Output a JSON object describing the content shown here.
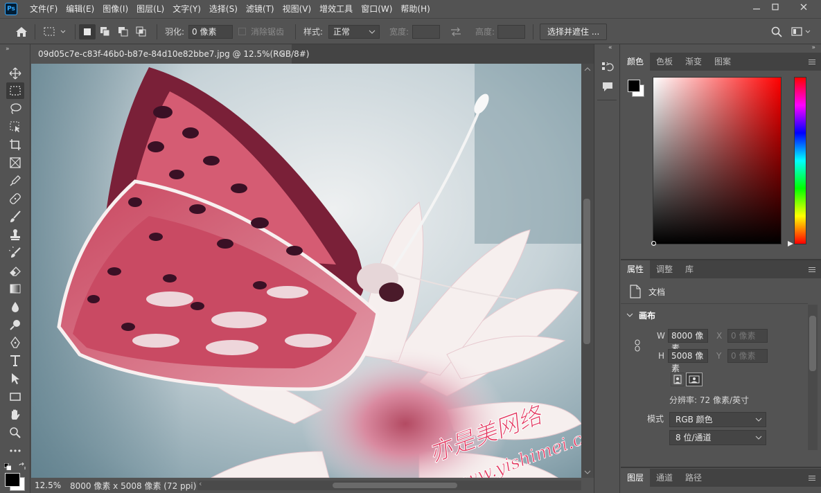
{
  "app": {
    "logo_text": "Ps"
  },
  "menu": [
    "文件(F)",
    "编辑(E)",
    "图像(I)",
    "图层(L)",
    "文字(Y)",
    "选择(S)",
    "滤镜(T)",
    "视图(V)",
    "增效工具",
    "窗口(W)",
    "帮助(H)"
  ],
  "options": {
    "feather_label": "羽化:",
    "feather_value": "0 像素",
    "antialias_label": "消除锯齿",
    "style_label": "样式:",
    "style_value": "正常",
    "width_label": "宽度:",
    "height_label": "高度:",
    "select_mask_label": "选择并遮住 ..."
  },
  "document": {
    "tab_title": "09d05c7e-c83f-46b0-b87e-84d10e82bbe7.jpg @ 12.5%(RGB/8#)",
    "watermark_cn": "亦是美网络",
    "watermark_url": "www.yishimei.cn"
  },
  "status": {
    "zoom": "12.5%",
    "doc_info": "8000 像素 x 5008 像素 (72 ppi)"
  },
  "color_panel": {
    "tabs": [
      "颜色",
      "色板",
      "渐变",
      "图案"
    ],
    "fg_color": "#000000",
    "bg_color": "#ffffff",
    "hue_color": "#ff0000"
  },
  "properties_panel": {
    "tabs": [
      "属性",
      "调整",
      "库"
    ],
    "doc_label": "文档",
    "section": "画布",
    "w_label": "W",
    "w_value": "8000 像素",
    "h_label": "H",
    "h_value": "5008 像素",
    "x_label": "X",
    "x_placeholder": "0 像素",
    "y_label": "Y",
    "y_placeholder": "0 像素",
    "resolution": "分辨率: 72 像素/英寸",
    "mode_label": "模式",
    "mode_value": "RGB 颜色",
    "depth_value": "8 位/通道"
  },
  "layers_panel": {
    "tabs": [
      "图层",
      "通道",
      "路径"
    ]
  }
}
